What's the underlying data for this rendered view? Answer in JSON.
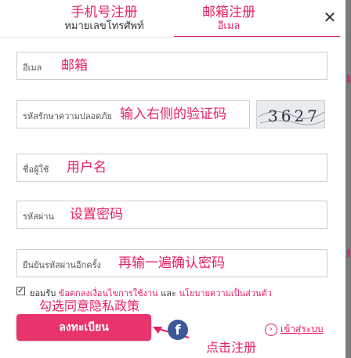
{
  "tabs": [
    {
      "zh": "手机号注册",
      "th": "หมายเลขโทรศัพท์"
    },
    {
      "zh": "邮箱注册",
      "th": "อีเมล"
    }
  ],
  "close_label": "✕",
  "fields": {
    "email": {
      "th": "อีเมล",
      "zh": "邮箱"
    },
    "captcha": {
      "th": "รหัสรักษาความปลอดภัย",
      "zh": "输入右侧的验证码",
      "code": "3627"
    },
    "username": {
      "th": "ชื่อผู้ใช้",
      "zh": "用户名"
    },
    "password": {
      "th": "รหัสผ่าน",
      "zh": "设置密码"
    },
    "confirm": {
      "th": "ยืนยันรหัสผ่านอีกครั้ง",
      "zh": "再输一遍确认密码"
    }
  },
  "agreement": {
    "prefix": "ยอมรับ",
    "terms_link": "ข้อตกลงเงื่อนไขการใช้งาน",
    "joiner": "และ",
    "privacy_link": "นโยบายความเป็นส่วนตัว",
    "annotation": "勾选同意隐私政策"
  },
  "submit": {
    "label": "ลงทะเบียน",
    "annotation": "点击注册"
  },
  "facebook_glyph": "f",
  "login_link": "เข้าสู่ระบบ",
  "colors": {
    "accent": "#e8215f",
    "button": "#e8336b",
    "facebook": "#3b5998"
  }
}
